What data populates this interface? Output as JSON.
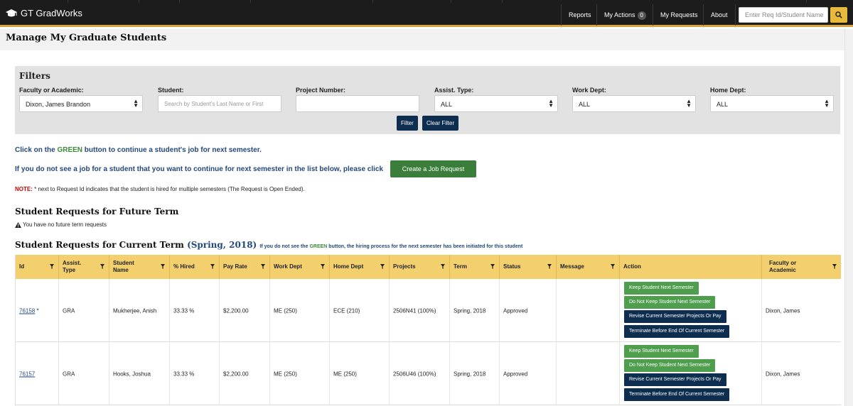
{
  "app": {
    "brand": "GT GradWorks"
  },
  "nav": {
    "reports": "Reports",
    "my_actions": "My Actions",
    "my_actions_count": "0",
    "my_requests": "My Requests",
    "about": "About",
    "search_placeholder": "Enter Req Id/Student Name"
  },
  "page": {
    "title": "Manage My Graduate Students"
  },
  "filters": {
    "title": "Filters",
    "faculty_label": "Faculty or Academic:",
    "faculty_value": "Dixon, James Brandon",
    "student_label": "Student:",
    "student_placeholder": "Search by Student's Last Name or First",
    "project_label": "Project Number:",
    "project_value": "",
    "assist_label": "Assist. Type:",
    "assist_value": "ALL",
    "work_label": "Work Dept:",
    "work_value": "ALL",
    "home_label": "Home Dept:",
    "home_value": "ALL",
    "filter_btn": "Filter",
    "clear_btn": "Clear Filter"
  },
  "info": {
    "line1_pre": "Click on the ",
    "line1_green": "GREEN",
    "line1_post": " button to continue a student's job for next semester.",
    "line2": "If you do not see a job for a student that you want to continue for next semester in the list below, please click",
    "create_btn": "Create a Job Request",
    "note_label": "NOTE:",
    "note_text": " * next to Request Id indicates that the student is hired for multiple semesters (The Request is Open Ended)."
  },
  "future": {
    "title": "Student Requests for Future Term",
    "empty": "You have no future term requests"
  },
  "current": {
    "title": "Student Requests for Current Term",
    "term": "(Spring, 2018)",
    "note_pre": "If you do not see the ",
    "note_green": "GREEN",
    "note_post": " button, the hiring process for the next semester has been initiated for this student"
  },
  "table": {
    "headers": {
      "id": "Id",
      "assist_type": "Assist. Type",
      "student_name": "Student Name",
      "hired": "% Hired",
      "pay_rate": "Pay Rate",
      "work_dept": "Work Dept",
      "home_dept": "Home Dept",
      "projects": "Projects",
      "term": "Term",
      "status": "Status",
      "message": "Message",
      "action": "Action",
      "faculty": "Faculty or Academic"
    },
    "actions": {
      "keep": "Keep Student Next Semester",
      "not_keep": "Do Not Keep Student Next Semester",
      "revise": "Revise Current Semester Projects Or Pay",
      "terminate": "Terminate Before End Of Current Semester"
    },
    "rows": [
      {
        "id": "76158",
        "star": " *",
        "type": "GRA",
        "name": "Mukherjee, Anish",
        "hired": "33.33 %",
        "pay": "$2,200.00",
        "work": "ME (250)",
        "home": "ECE (210)",
        "projects": "2506N41 (100%)",
        "term": "Spring, 2018",
        "status": "Approved",
        "message": "",
        "faculty": "Dixon, James"
      },
      {
        "id": "76157",
        "star": "",
        "type": "GRA",
        "name": "Hooks, Joshua",
        "hired": "33.33 %",
        "pay": "$2,200.00",
        "work": "ME (250)",
        "home": "ME (250)",
        "projects": "2506U46 (100%)",
        "term": "Spring, 2018",
        "status": "Approved",
        "message": "",
        "faculty": "Dixon, James"
      }
    ]
  }
}
